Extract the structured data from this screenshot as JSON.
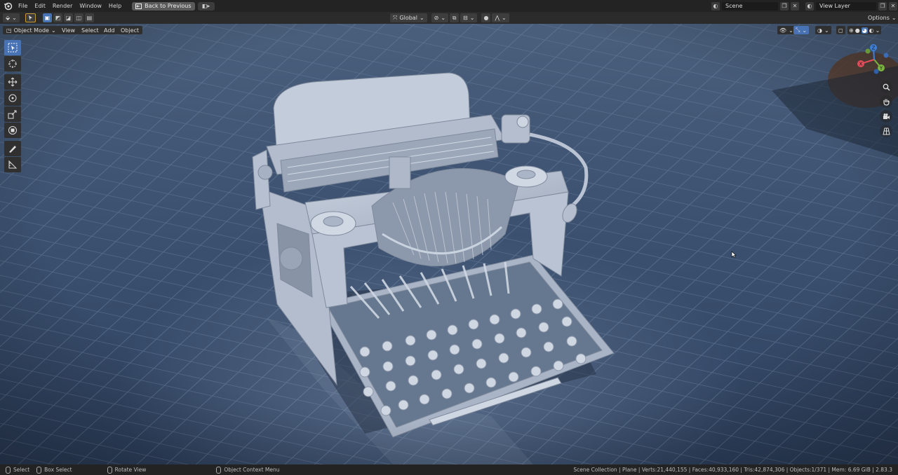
{
  "menubar": {
    "items": [
      "File",
      "Edit",
      "Render",
      "Window",
      "Help"
    ],
    "back_button": "Back to Previous",
    "scene_name": "Scene",
    "view_layer": "View Layer"
  },
  "tool_header": {
    "transform_orientation": "Global",
    "options_label": "Options"
  },
  "viewport_header": {
    "mode": "Object Mode",
    "menus": [
      "View",
      "Select",
      "Add",
      "Object"
    ]
  },
  "toolbar": {
    "tools": [
      "select-box",
      "cursor",
      "move",
      "rotate",
      "scale",
      "transform",
      "annotate",
      "measure"
    ],
    "active_tool": "select-box"
  },
  "gizmo": {
    "axes": [
      "X",
      "Y",
      "Z"
    ]
  },
  "statusbar": {
    "hints": [
      "Select",
      "Box Select",
      "Rotate View",
      "Object Context Menu"
    ],
    "info": "Scene Collection | Plane | Verts:21,440,155 | Faces:40,933,160 | Tris:42,874,306 | Objects:1/371 | Mem: 6.69 GiB | 2.83.3"
  },
  "colors": {
    "accent": "#4772b3",
    "floor_tile": "#3f5573",
    "model": "#b8c2d4",
    "x_axis": "#e04c5a",
    "y_axis": "#7bb33f",
    "z_axis": "#3f7fd8"
  }
}
